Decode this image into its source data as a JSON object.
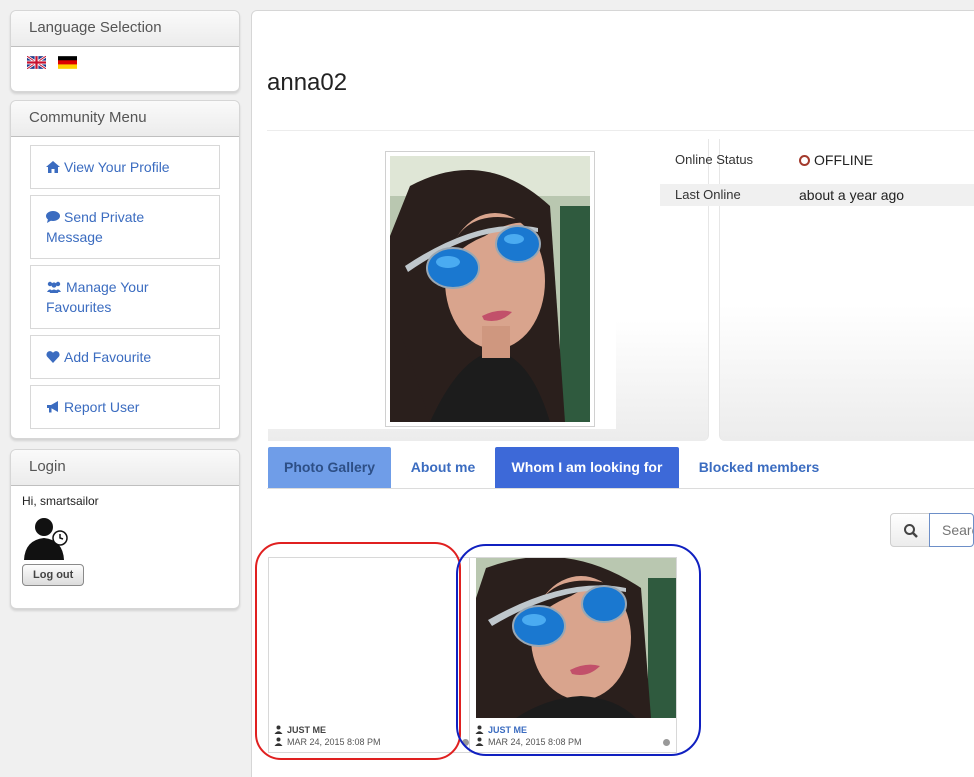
{
  "sidebar": {
    "language": {
      "title": "Language Selection",
      "flags": [
        "english-flag-icon",
        "german-flag-icon"
      ]
    },
    "community": {
      "title": "Community Menu",
      "items": [
        {
          "label": "View Your Profile",
          "icon": "home-icon"
        },
        {
          "label": "Send Private Message",
          "icon": "chat-bubble-icon"
        },
        {
          "label": "Manage Your Favourites",
          "icon": "users-icon"
        },
        {
          "label": "Add Favourite",
          "icon": "heart-icon"
        },
        {
          "label": "Report User",
          "icon": "megaphone-icon"
        }
      ]
    },
    "login": {
      "title": "Login",
      "greeting": "Hi, smartsailor",
      "logout_label": "Log out"
    }
  },
  "profile": {
    "username": "anna02",
    "online_status_label": "Online Status",
    "online_status_value": "OFFLINE",
    "last_online_label": "Last Online",
    "last_online_value": "about a year ago"
  },
  "tabs": [
    {
      "label": "Photo Gallery"
    },
    {
      "label": "About me"
    },
    {
      "label": "Whom I am looking for"
    },
    {
      "label": "Blocked members"
    }
  ],
  "search": {
    "placeholder": "Search"
  },
  "gallery": [
    {
      "privacy": "JUST ME",
      "date": "MAR 24, 2015 8:08 PM"
    },
    {
      "privacy": "JUST ME",
      "date": "MAR 24, 2015 8:08 PM"
    }
  ],
  "colors": {
    "link": "#3b6cc0",
    "offline": "#a33a2c",
    "tab_active": "#3d69d8",
    "tab_highlight": "#6f9de8"
  }
}
